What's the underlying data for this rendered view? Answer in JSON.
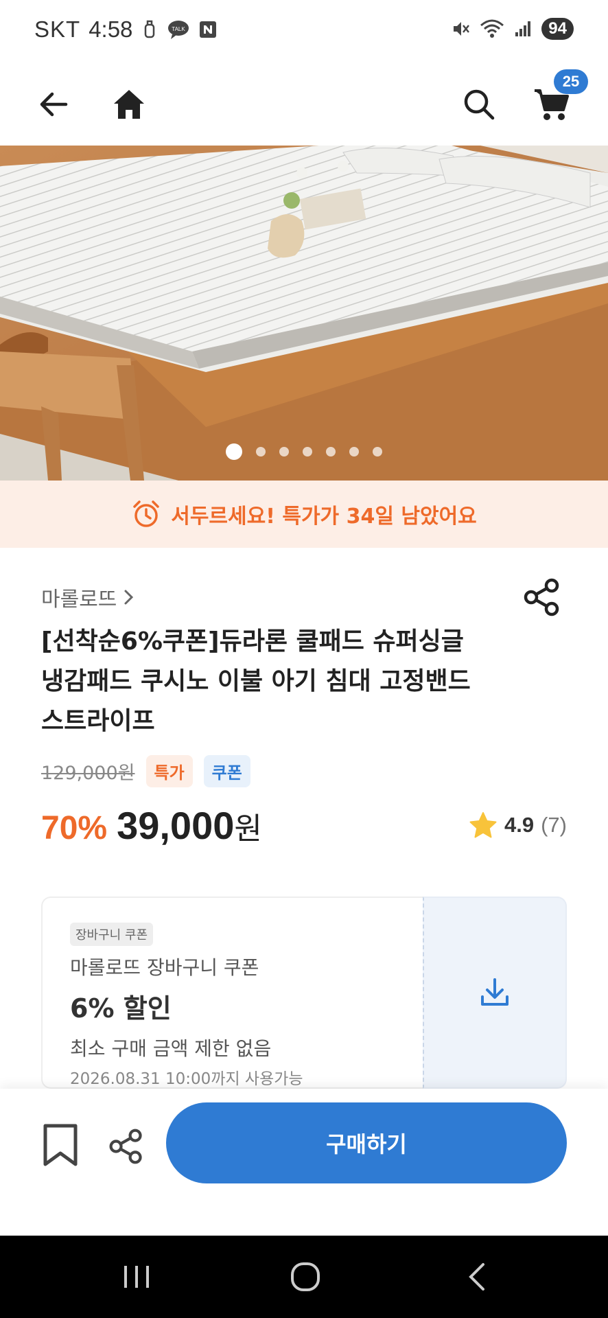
{
  "status_bar": {
    "carrier": "SKT",
    "time": "4:58",
    "battery": "94"
  },
  "app_bar": {
    "cart_count": "25"
  },
  "hero": {
    "image_count": 7,
    "active_index": 0
  },
  "deal_banner": {
    "text": "서두르세요! 특가가 34일 남았어요",
    "color": "#ee6a2a"
  },
  "product": {
    "brand": "마롤로뜨",
    "title_lines": [
      "[선착순6%쿠폰]듀라론 쿨패드 슈퍼싱글",
      "냉감패드 쿠시노 이불 아기 침대 고정밴드",
      "스트라이프"
    ],
    "original_price": "129,000원",
    "tag_deal": "특가",
    "tag_coupon": "쿠폰",
    "discount": "70%",
    "price": "39,000",
    "currency": "원",
    "rating": "4.9",
    "review_count": "(7)"
  },
  "coupon": {
    "chip": "장바구니 쿠폰",
    "name": "마롤로뜨 장바구니 쿠폰",
    "discount": "6% 할인",
    "min_purchase": "최소 구매 금액 제한 없음",
    "expires": "2026.08.31 10:00까지 사용가능"
  },
  "bottom_bar": {
    "buy_label": "구매하기"
  },
  "colors": {
    "accent_blue": "#2f7bd3",
    "accent_orange": "#ee6a2a"
  }
}
